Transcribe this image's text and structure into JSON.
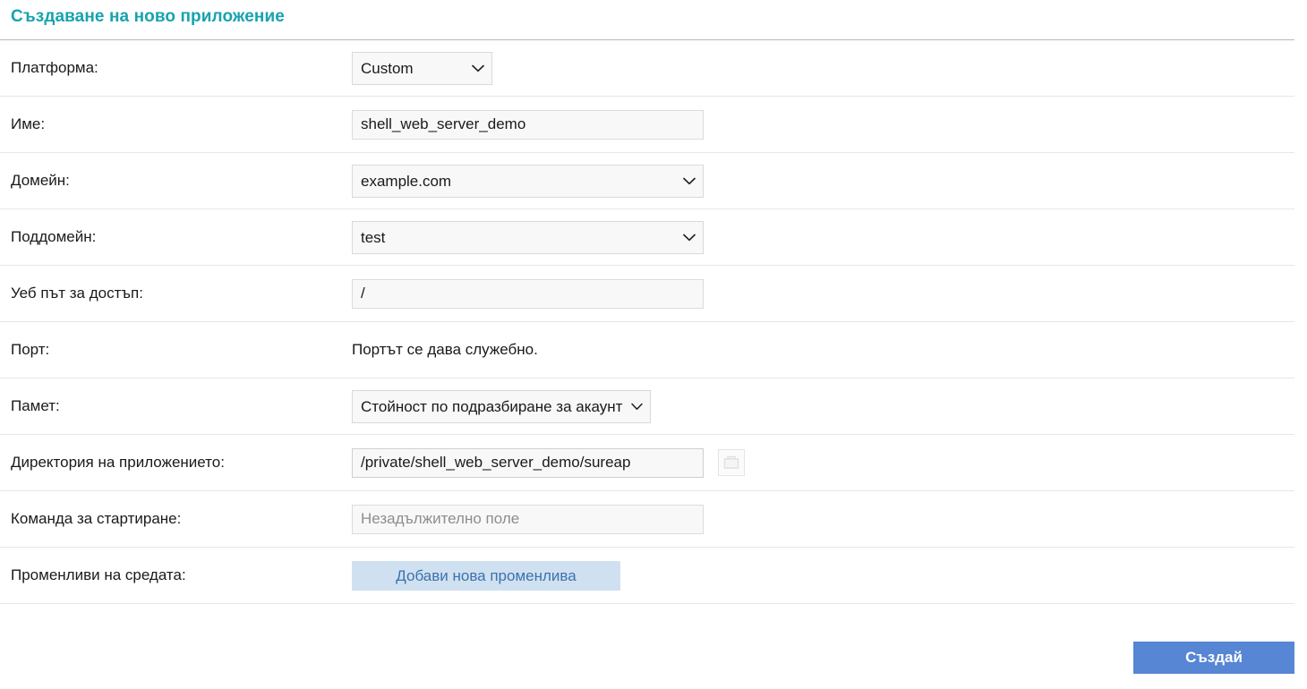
{
  "header": {
    "title": "Създаване на ново приложение",
    "title_color": "#17a3ae"
  },
  "form": {
    "rows": [
      {
        "label": "Платформа:",
        "control": "select",
        "value": "Custom"
      },
      {
        "label": "Име:",
        "control": "text",
        "value": "shell_web_server_demo",
        "placeholder": ""
      },
      {
        "label": "Домейн:",
        "control": "select",
        "value": "example.com"
      },
      {
        "label": "Поддомейн:",
        "control": "select",
        "value": "test"
      },
      {
        "label": "Уеб път за достъп:",
        "control": "text",
        "value": "/",
        "placeholder": ""
      },
      {
        "label": "Порт:",
        "control": "static",
        "value": "Портът се дава служебно."
      },
      {
        "label": "Памет:",
        "control": "select",
        "value": "Стойност по подразбиране за акаунт"
      },
      {
        "label": "Директория на приложението:",
        "control": "text-with-browse",
        "value": "/private/shell_web_server_demo/sureap",
        "placeholder": "",
        "browse_icon": "folder-icon"
      },
      {
        "label": "Команда за стартиране:",
        "control": "text",
        "value": "",
        "placeholder": "Незадължително поле"
      },
      {
        "label": "Променливи на средата:",
        "control": "button",
        "value": "Добави нова променлива"
      }
    ]
  },
  "footer": {
    "submit_label": "Създай",
    "submit_color": "#5686d4"
  },
  "icons": {
    "chevron_down": "chevron-down-icon",
    "folder": "folder-icon"
  }
}
